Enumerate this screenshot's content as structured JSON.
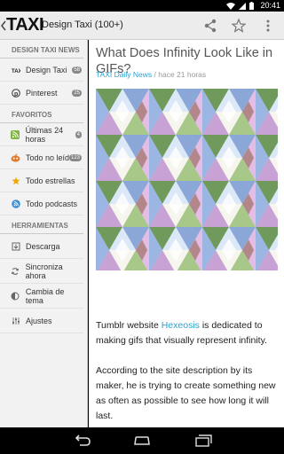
{
  "status_bar": {
    "time": "20:41"
  },
  "action_bar": {
    "logo": "TAXI",
    "title": "Design Taxi (100+)"
  },
  "drawer": {
    "sections": [
      {
        "label": "DESIGN TAXI NEWS"
      },
      {
        "label": "FAVORITOS"
      },
      {
        "label": "HERRAMIENTAS"
      }
    ],
    "feeds": [
      {
        "label": "Design Taxi",
        "badge": "58",
        "icon": "taxi-icon"
      },
      {
        "label": "Pinterest",
        "badge": "25",
        "icon": "pinterest-icon"
      }
    ],
    "favorites": [
      {
        "label": "Últimas 24 horas",
        "badge": "4",
        "icon": "rss-icon"
      },
      {
        "label": "Todo no leído",
        "badge": "123",
        "icon": "reader-icon"
      },
      {
        "label": "Todo estrellas",
        "badge": "",
        "icon": "star-icon"
      },
      {
        "label": "Todo podcasts",
        "badge": "",
        "icon": "podcast-icon"
      }
    ],
    "tools": [
      {
        "label": "Descarga",
        "icon": "download-icon"
      },
      {
        "label": "Sincroniza ahora",
        "icon": "sync-icon"
      },
      {
        "label": "Cambia de tema",
        "icon": "theme-icon"
      },
      {
        "label": "Ajustes",
        "icon": "settings-icon"
      }
    ]
  },
  "article": {
    "title": "What Does Infinity Look Like in GIFs?",
    "source": "TAXI Daily News",
    "separator": " / ",
    "time_ago": "hace 21 horas",
    "paragraph1_pre": "Tumblr website ",
    "paragraph1_link": "Hexeosis",
    "paragraph1_post": " is dedicated to making gifs that visually represent infinity.",
    "paragraph2": "According to the site description by its maker, he is trying to create something new as often as possible to see how long it will last."
  },
  "colors": {
    "accent_link": "#2aa3cf",
    "action_bar_bg": "#ececec",
    "drawer_bg": "#f2f2f2"
  }
}
